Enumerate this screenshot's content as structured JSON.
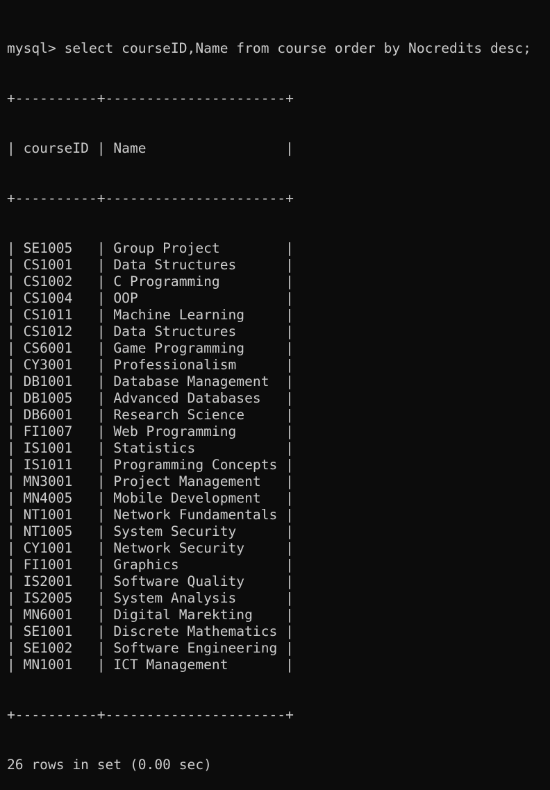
{
  "terminal": {
    "background": "#0c0c0c",
    "foreground": "#cccccc",
    "prompt": "mysql>",
    "command": "select courseID,Name from course order by Nocredits desc;",
    "border": "+----------+----------------------+",
    "header": {
      "courseID": "courseID",
      "name": "Name"
    },
    "rows": [
      {
        "courseID": "SE1005",
        "name": "Group Project"
      },
      {
        "courseID": "CS1001",
        "name": "Data Structures"
      },
      {
        "courseID": "CS1002",
        "name": "C Programming"
      },
      {
        "courseID": "CS1004",
        "name": "OOP"
      },
      {
        "courseID": "CS1011",
        "name": "Machine Learning"
      },
      {
        "courseID": "CS1012",
        "name": "Data Structures"
      },
      {
        "courseID": "CS6001",
        "name": "Game Programming"
      },
      {
        "courseID": "CY3001",
        "name": "Professionalism"
      },
      {
        "courseID": "DB1001",
        "name": "Database Management"
      },
      {
        "courseID": "DB1005",
        "name": "Advanced Databases"
      },
      {
        "courseID": "DB6001",
        "name": "Research Science"
      },
      {
        "courseID": "FI1007",
        "name": "Web Programming"
      },
      {
        "courseID": "IS1001",
        "name": "Statistics"
      },
      {
        "courseID": "IS1011",
        "name": "Programming Concepts"
      },
      {
        "courseID": "MN3001",
        "name": "Project Management"
      },
      {
        "courseID": "MN4005",
        "name": "Mobile Development"
      },
      {
        "courseID": "NT1001",
        "name": "Network Fundamentals"
      },
      {
        "courseID": "NT1005",
        "name": "System Security"
      },
      {
        "courseID": "CY1001",
        "name": "Network Security"
      },
      {
        "courseID": "FI1001",
        "name": "Graphics"
      },
      {
        "courseID": "IS2001",
        "name": "Software Quality"
      },
      {
        "courseID": "IS2005",
        "name": "System Analysis"
      },
      {
        "courseID": "MN6001",
        "name": "Digital Marekting"
      },
      {
        "courseID": "SE1001",
        "name": "Discrete Mathematics"
      },
      {
        "courseID": "SE1002",
        "name": "Software Engineering"
      },
      {
        "courseID": "MN1001",
        "name": "ICT Management"
      }
    ],
    "summary": "26 rows in set (0.00 sec)"
  }
}
